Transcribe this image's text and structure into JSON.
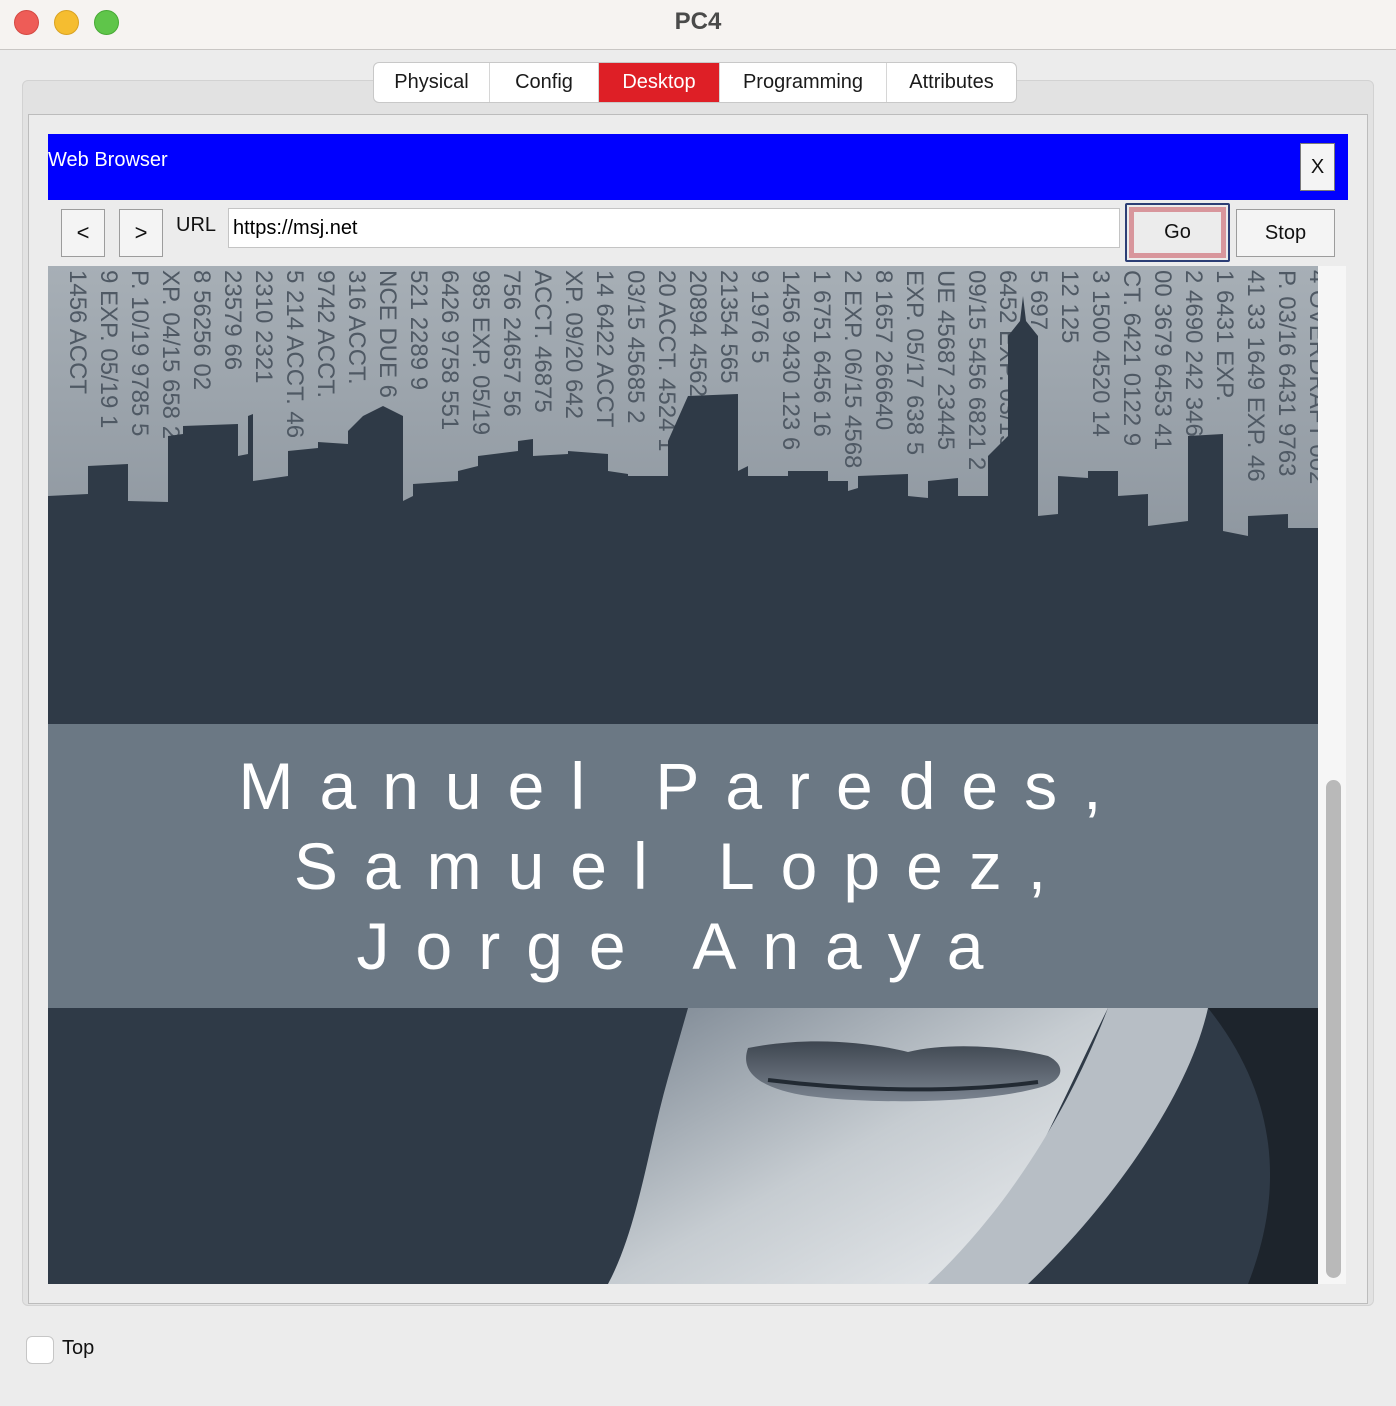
{
  "window": {
    "title": "PC4"
  },
  "tabs": [
    {
      "label": "Physical",
      "active": false
    },
    {
      "label": "Config",
      "active": false
    },
    {
      "label": "Desktop",
      "active": true
    },
    {
      "label": "Programming",
      "active": false
    },
    {
      "label": "Attributes",
      "active": false
    }
  ],
  "browser": {
    "title": "Web Browser",
    "close_label": "X",
    "back_label": "<",
    "forward_label": ">",
    "url_label": "URL",
    "url_value": "https://msj.net",
    "go_label": "Go",
    "stop_label": "Stop"
  },
  "webpage": {
    "banner_text": "Manuel Paredes, Samuel Lopez, Jorge Anaya",
    "background_text_columns": [
      "4 OVERDRAFT 002",
      "P. 03/16 6431 9763",
      "41 33 1649 EXP. 46",
      "1 6431 EXP.",
      "2 4690 242 346",
      "00 3679 6453 41",
      "CT. 6421 0122 9",
      "3 1500 4520 14",
      "12 125",
      "5 697",
      "6452 EXP. 03/15 1",
      "09/15 5456 6821 2",
      "UE 45687 23445",
      "EXP. 05/17 638 5",
      "8 1657 266640",
      "2 EXP. 06/15 4568",
      "1 6751 6456 16",
      "1456 9430 123 6",
      "9 1976 5",
      "21354 565",
      "20894 4562 1211 0",
      "20 ACCT. 4524 1",
      "03/15 45685 2",
      "14 6422 ACCT",
      "XP. 09/20 642",
      "ACCT. 46875",
      "756 24657 56",
      "985 EXP. 05/19",
      "6426 9758 551",
      "521 2289 9",
      "NCE DUE 6",
      "316 ACCT.",
      "9742 ACCT.",
      "5 214 ACCT. 46",
      "2310 2321",
      "23579 66",
      "8 56256 02",
      "XP. 04/15 658 2",
      "P. 10/19 9785 5",
      "9 EXP. 05/19 1",
      "1456 ACCT"
    ]
  },
  "footer": {
    "checkbox_label": "Top",
    "checked": false
  },
  "colors": {
    "active_tab": "#de1f26",
    "browser_bar": "#0000ff",
    "banner": "#6b7884",
    "skyline": "#2f3a47",
    "go_highlight": "#d8969c"
  }
}
